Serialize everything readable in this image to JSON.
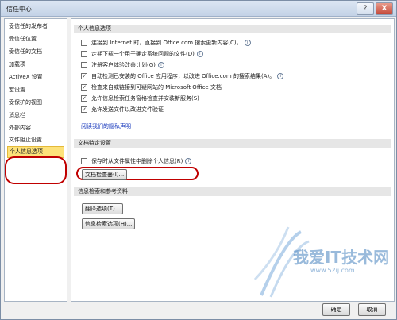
{
  "window": {
    "title": "信任中心",
    "help_glyph": "?",
    "close_glyph": "X"
  },
  "sidebar": {
    "items": [
      {
        "label": "受信任的发布者"
      },
      {
        "label": "受信任位置"
      },
      {
        "label": "受信任的文档"
      },
      {
        "label": "加载项"
      },
      {
        "label": "ActiveX 设置"
      },
      {
        "label": "宏设置"
      },
      {
        "label": "受保护的视图"
      },
      {
        "label": "消息栏"
      },
      {
        "label": "外部内容"
      },
      {
        "label": "文件阻止设置"
      },
      {
        "label": "个人信息选项",
        "selected": true
      }
    ]
  },
  "personal": {
    "heading": "个人信息选项",
    "options": [
      {
        "label": "连接到 Internet 时，直接到 Office.com 搜索更新内容(C)。",
        "checked": false,
        "info": true
      },
      {
        "label": "定期下载一个用于确定系统问题的文件(D)",
        "checked": false,
        "info": true
      },
      {
        "label": "注册客户体验改善计划(G)",
        "checked": false,
        "info": true
      },
      {
        "label": "自动检测已安装的 Office 应用程序，以改进 Office.com 的搜索结果(A)。",
        "checked": true,
        "info": true
      },
      {
        "label": "检查来自或链接到可疑网站的 Microsoft Office 文档",
        "checked": true,
        "info": false
      },
      {
        "label": "允许信息检索任务窗格检查并安装新服务(S)",
        "checked": true,
        "info": false
      },
      {
        "label": "允许发送文件以改进文件验证",
        "checked": true,
        "info": false
      }
    ],
    "privacy_link": "阅读我们的隐私声明"
  },
  "doc_specific": {
    "heading": "文档特定设置",
    "remove_info": {
      "label": "保存时从文件属性中删除个人信息(R)",
      "checked": false
    },
    "inspector_button": "文档检查器(I)..."
  },
  "research": {
    "heading": "信息检索和参考资料",
    "translation_button": "翻译选项(T)...",
    "research_button": "信息检索选项(H)..."
  },
  "footer": {
    "ok": "确定",
    "cancel": "取消"
  },
  "watermark": {
    "text": "我爱IT技术网",
    "sub": "www.52ij.com"
  },
  "colors": {
    "selected_bg": "#fde27a",
    "highlight_ring": "#c00000",
    "link": "#1f3fbf"
  }
}
